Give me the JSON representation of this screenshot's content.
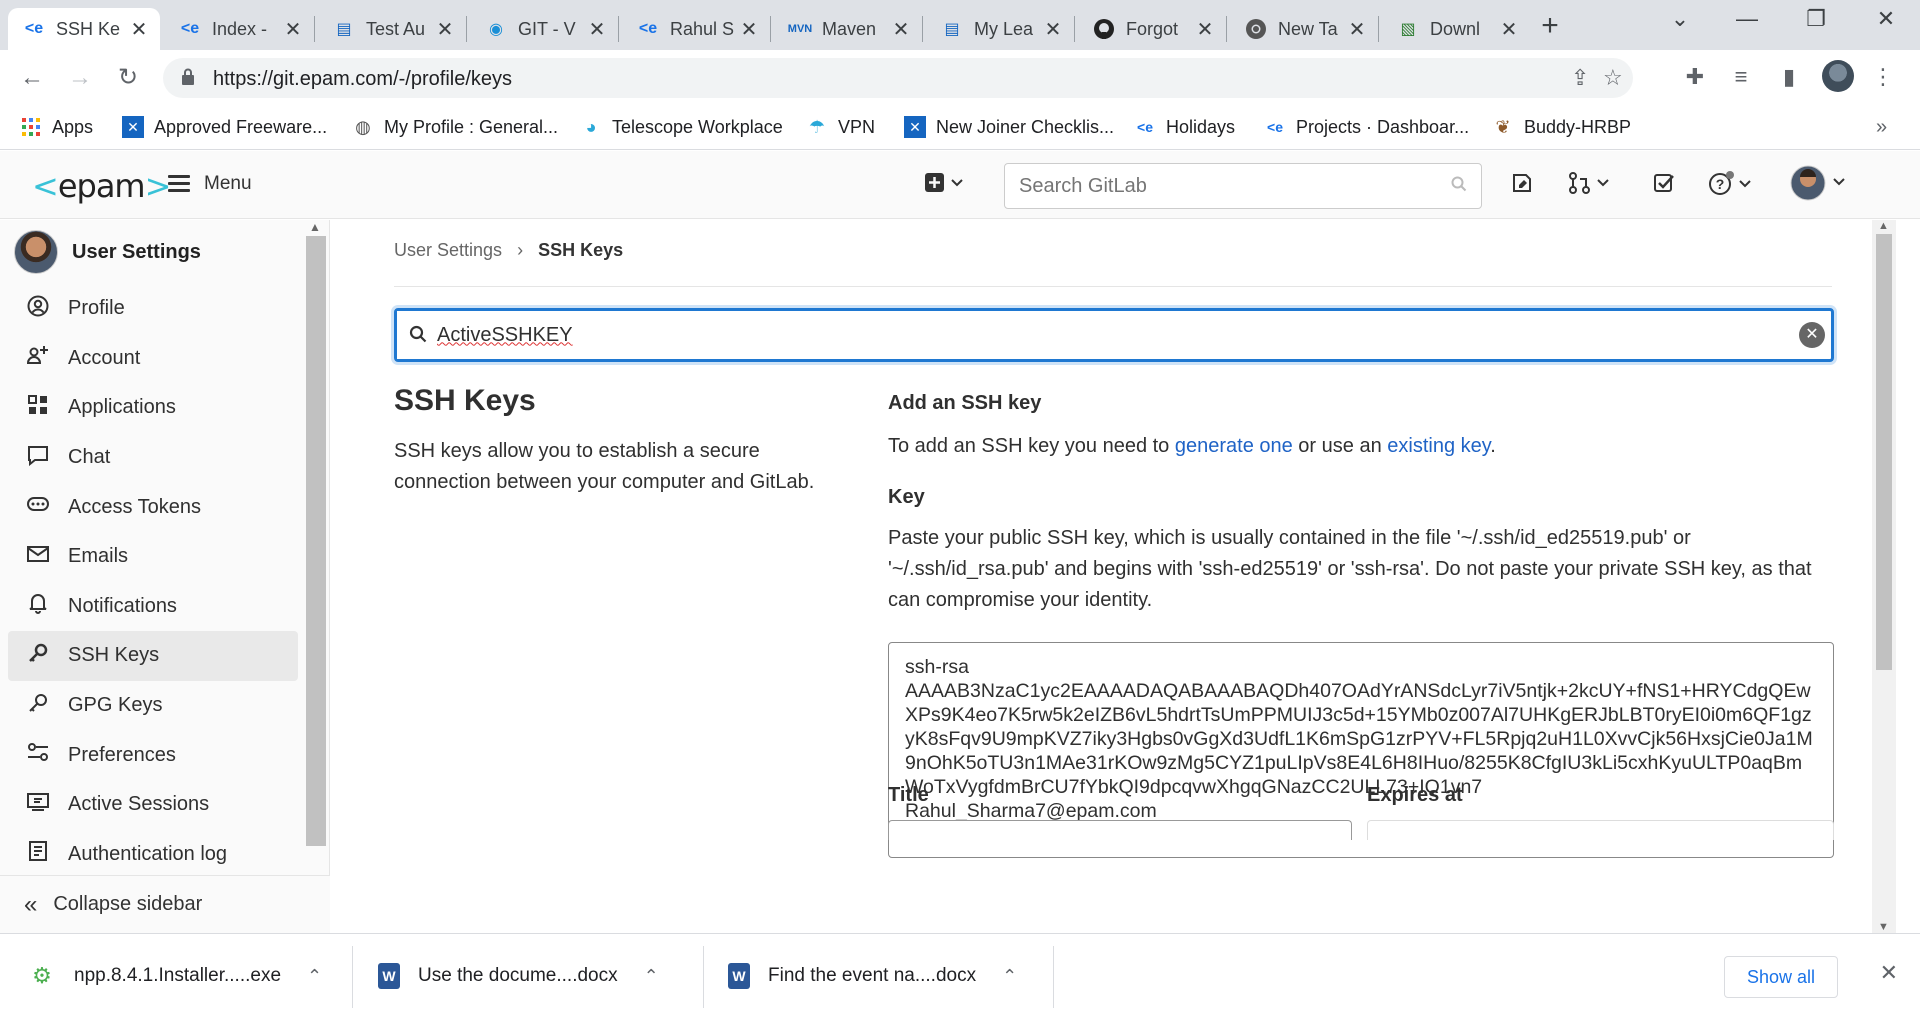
{
  "browser": {
    "tabs": [
      {
        "title": "SSH Ke",
        "icon": "epam-icon",
        "active": true
      },
      {
        "title": "Index -",
        "icon": "epam-icon"
      },
      {
        "title": "Test Au",
        "icon": "book-icon"
      },
      {
        "title": "GIT - V",
        "icon": "video-icon"
      },
      {
        "title": "Rahul S",
        "icon": "epam-icon"
      },
      {
        "title": "Maven",
        "icon": "mvn-icon"
      },
      {
        "title": "My Lea",
        "icon": "book-icon"
      },
      {
        "title": "Forgot",
        "icon": "github-icon"
      },
      {
        "title": "New Ta",
        "icon": "chrome-icon"
      },
      {
        "title": "Downl",
        "icon": "doc-icon"
      }
    ],
    "url": "https://git.epam.com/-/profile/keys",
    "bookmarks": [
      {
        "label": "Apps",
        "icon": "apps-grid-icon"
      },
      {
        "label": "Approved Freeware...",
        "icon": "x-icon"
      },
      {
        "label": "My Profile : General...",
        "icon": "globe-icon"
      },
      {
        "label": "Telescope Workplace",
        "icon": "telescope-icon"
      },
      {
        "label": "VPN",
        "icon": "umbrella-icon"
      },
      {
        "label": "New Joiner Checklis...",
        "icon": "x-icon"
      },
      {
        "label": "Holidays",
        "icon": "epam-icon"
      },
      {
        "label": "Projects · Dashboar...",
        "icon": "epam-icon"
      },
      {
        "label": "Buddy-HRBP",
        "icon": "dog-icon"
      }
    ]
  },
  "header": {
    "logo": "epam",
    "menu_label": "Menu",
    "search_placeholder": "Search GitLab"
  },
  "sidebar": {
    "title": "User Settings",
    "items": [
      {
        "label": "Profile",
        "icon": "profile-icon"
      },
      {
        "label": "Account",
        "icon": "account-icon"
      },
      {
        "label": "Applications",
        "icon": "applications-icon"
      },
      {
        "label": "Chat",
        "icon": "chat-icon"
      },
      {
        "label": "Access Tokens",
        "icon": "token-icon"
      },
      {
        "label": "Emails",
        "icon": "mail-icon"
      },
      {
        "label": "Notifications",
        "icon": "bell-icon"
      },
      {
        "label": "SSH Keys",
        "icon": "key-icon",
        "active": true
      },
      {
        "label": "GPG Keys",
        "icon": "key-icon"
      },
      {
        "label": "Preferences",
        "icon": "preferences-icon"
      },
      {
        "label": "Active Sessions",
        "icon": "monitor-icon"
      },
      {
        "label": "Authentication log",
        "icon": "log-icon"
      }
    ],
    "collapse_label": "Collapse sidebar"
  },
  "main": {
    "breadcrumb": {
      "parent": "User Settings",
      "current": "SSH Keys"
    },
    "filter_value": "ActiveSSHKEY",
    "title": "SSH Keys",
    "description": "SSH keys allow you to establish a secure connection between your computer and GitLab.",
    "add_heading": "Add an SSH key",
    "add_text_prefix": "To add an SSH key you need to ",
    "add_link1": "generate one",
    "add_text_mid": " or use an ",
    "add_link2": "existing key",
    "add_text_suffix": ".",
    "key_heading": "Key",
    "key_help": "Paste your public SSH key, which is usually contained in the file '~/.ssh/id_ed25519.pub' or '~/.ssh/id_rsa.pub' and begins with 'ssh-ed25519' or 'ssh-rsa'. Do not paste your private SSH key, as that can compromise your identity.",
    "key_value": "ssh-rsa\nAAAAB3NzaC1yc2EAAAADAQABAAABAQDh407OAdYrANSdcLyr7iV5ntjk+2kcUY+fNS1+HRYCdgQEwXPs9K4eo7K5rw5k2eIZB6vL5hdrtTsUmPPMUIJ3c5d+15YMb0z007Al7UHKgERJbLBT0ryEI0i0m6QF1gzyK8sFqv9U9mpKVZ7iky3Hgbs0vGgXd3UdfL1K6mSpG1zrPYV+FL5Rpjq2uH1L0XvvCjk56HxsjCie0Ja1M9nOhK5oTU3n1MAe31rKOw9zMg5CYZ1puLIpVs8E4L6H8IHuo/8255K8CfgIU3kLi5cxhKyuULTP0aqBmWoTxVygfdmBrCU7fYbkQI9dpcqvwXhgqGNazCC2ULL73+IQ1vn7\nRahul_Sharma7@epam.com",
    "title_label": "Title",
    "expires_label": "Expires at"
  },
  "downloads": [
    {
      "name": "npp.8.4.1.Installer.....exe",
      "icon": "installer-icon"
    },
    {
      "name": "Use the docume....docx",
      "icon": "word-doc-icon"
    },
    {
      "name": "Find the event na....docx",
      "icon": "word-doc-icon"
    }
  ],
  "downloads_show_all": "Show all"
}
